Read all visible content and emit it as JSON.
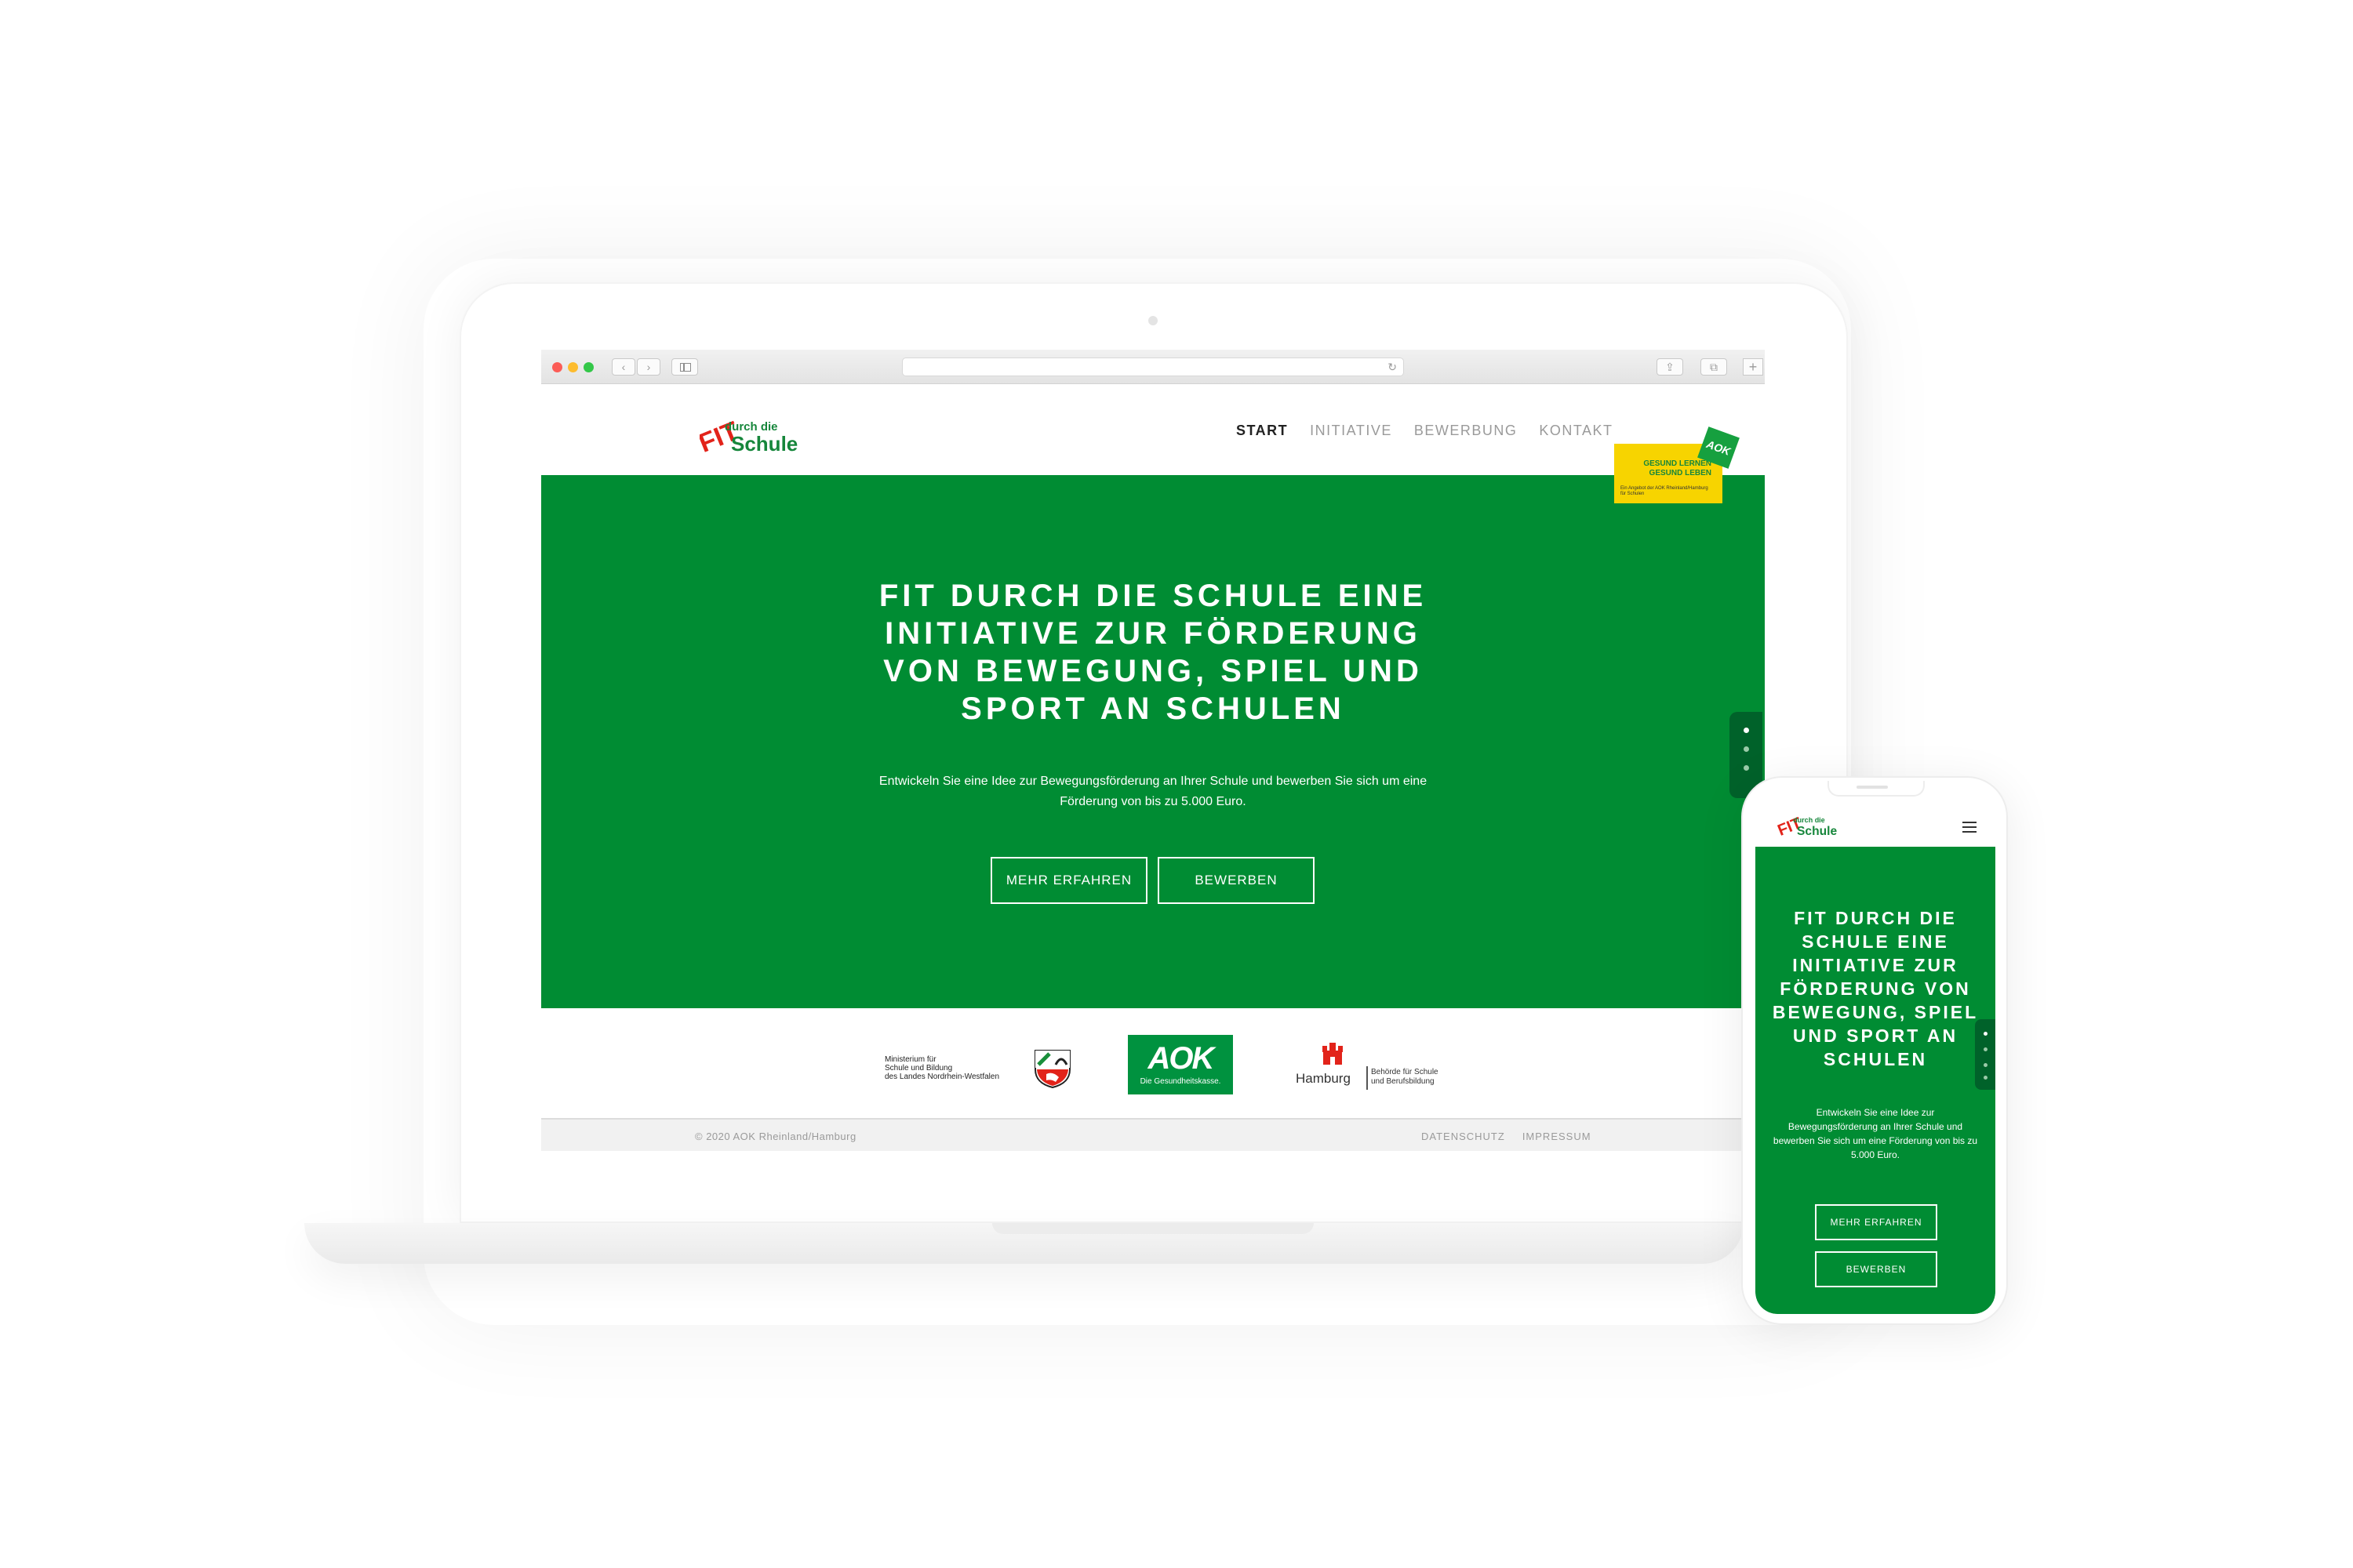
{
  "browser": {
    "back_icon": "chevron-left-icon",
    "forward_icon": "chevron-right-icon",
    "reload_icon": "reload-icon",
    "back_glyph": "‹",
    "forward_glyph": "›",
    "reload_glyph": "↻",
    "share_glyph": "⇪",
    "tabs_glyph": "⧉",
    "plus_glyph": "+"
  },
  "brand": {
    "logo_fit": "FIT",
    "logo_durch": "durch die",
    "logo_schule": "Schule",
    "colors": {
      "green": "#008c33",
      "dark_green": "#00622a",
      "red": "#e2231a",
      "yellow": "#f7d400"
    }
  },
  "nav": {
    "items": [
      {
        "label": "START",
        "active": true
      },
      {
        "label": "INITIATIVE",
        "active": false
      },
      {
        "label": "BEWERBUNG",
        "active": false
      },
      {
        "label": "KONTAKT",
        "active": false
      }
    ]
  },
  "badge": {
    "line1": "GESUND LERNEN",
    "line2": "GESUND LEBEN",
    "small": "Ein Angebot der AOK Rheinland/Hamburg für Schulen",
    "logo": "AOK"
  },
  "hero": {
    "title": "FIT DURCH DIE SCHULE EINE INITIATIVE ZUR FÖRDERUNG VON BEWEGUNG, SPIEL UND SPORT AN SCHULEN",
    "text": "Entwickeln Sie eine Idee zur Bewegungsförderung an Ihrer Schule und bewerben Sie sich um eine Förderung von bis zu 5.000 Euro.",
    "btn_more": "MEHR ERFAHREN",
    "btn_apply": "BEWERBEN"
  },
  "partners": {
    "nrw_line1": "Ministerium für",
    "nrw_line2": "Schule und Bildung",
    "nrw_line3": "des Landes Nordrhein-Westfalen",
    "aok": "AOK",
    "aok_sub": "Die Gesundheitskasse.",
    "hh_name": "Hamburg",
    "hh_line1": "Behörde für Schule",
    "hh_line2": "und Berufsbildung"
  },
  "footer": {
    "copyright": "© 2020 AOK Rheinland/Hamburg",
    "links": [
      "DATENSCHUTZ",
      "IMPRESSUM"
    ]
  },
  "mobile": {
    "menu_icon": "hamburger-menu-icon"
  }
}
